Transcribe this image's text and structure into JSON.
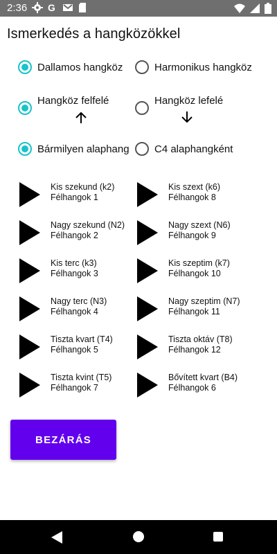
{
  "status": {
    "time": "2:36"
  },
  "title": "Ismerkedés a hangközökkel",
  "options": {
    "melodic": "Dallamos hangköz",
    "harmonic": "Harmonikus hangköz",
    "up": "Hangköz felfelé",
    "down": "Hangköz lefelé",
    "any_root": "Bármilyen alaphang",
    "c4_root": "C4 alaphangként"
  },
  "intervals": [
    {
      "name": "Kis szekund (k2)",
      "semitones": "Félhangok 1"
    },
    {
      "name": "Kis szext (k6)",
      "semitones": "Félhangok 8"
    },
    {
      "name": "Nagy szekund (N2)",
      "semitones": "Félhangok 2"
    },
    {
      "name": "Nagy szext (N6)",
      "semitones": "Félhangok 9"
    },
    {
      "name": "Kis terc (k3)",
      "semitones": "Félhangok 3"
    },
    {
      "name": "Kis szeptim (k7)",
      "semitones": "Félhangok 10"
    },
    {
      "name": "Nagy terc (N3)",
      "semitones": "Félhangok 4"
    },
    {
      "name": "Nagy szeptim (N7)",
      "semitones": "Félhangok 11"
    },
    {
      "name": "Tiszta kvart (T4)",
      "semitones": "Félhangok 5"
    },
    {
      "name": "Tiszta oktáv (T8)",
      "semitones": "Félhangok 12"
    },
    {
      "name": "Tiszta kvint (T5)",
      "semitones": "Félhangok 7"
    },
    {
      "name": "Bővített kvart (B4)",
      "semitones": "Félhangok 6"
    }
  ],
  "close_label": "BEZÁRÁS",
  "colors": {
    "accent": "#18c3c9",
    "button": "#6200ee",
    "statusbar": "#6f6f6f"
  }
}
